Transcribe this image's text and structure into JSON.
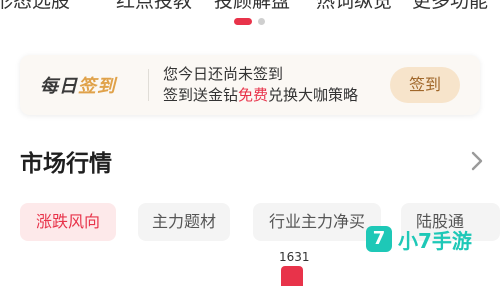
{
  "top_nav": {
    "items": [
      "形态选股",
      "红点投教",
      "投顾解盘",
      "热词纵览",
      "更多功能"
    ]
  },
  "checkin": {
    "logo_part1": "每日",
    "logo_part2": "签到",
    "line1": "您今日还尚未签到",
    "line2_prefix": "签到送金钻",
    "line2_highlight": "免费",
    "line2_suffix": "兑换大咖策略",
    "button": "签到"
  },
  "market": {
    "title": "市场行情",
    "chevron_icon": "chevron-right-icon",
    "tabs": [
      {
        "label": "涨跌风向",
        "active": true
      },
      {
        "label": "主力题材",
        "active": false
      },
      {
        "label": "行业主力净买",
        "active": false
      },
      {
        "label": "陆股通",
        "active": false
      }
    ],
    "marker_value": "1631"
  },
  "watermark": {
    "icon_glyph": "7",
    "text": "小7手游"
  },
  "colors": {
    "accent": "#e8334a",
    "gold": "#e0a24a",
    "watermark": "#1ec8b7"
  }
}
